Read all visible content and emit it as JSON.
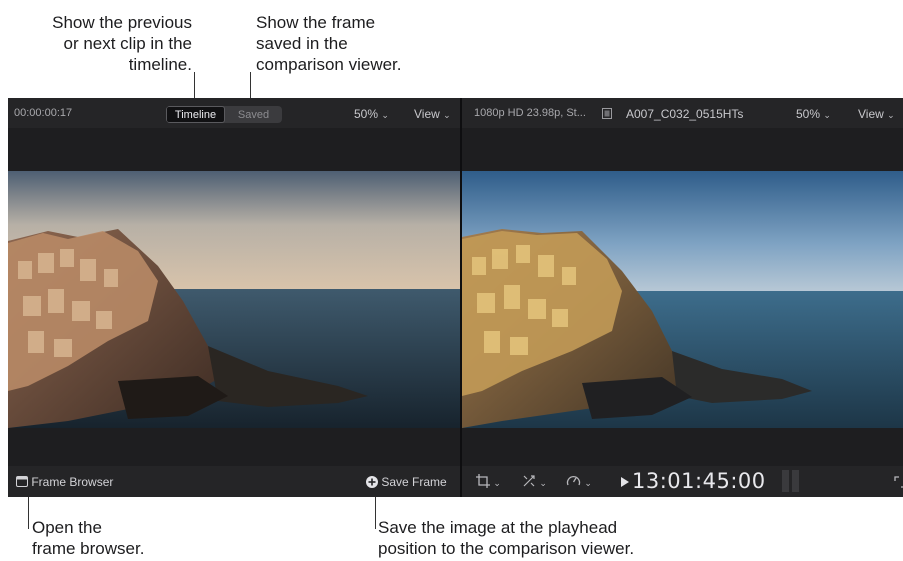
{
  "callouts": {
    "prev_next": "Show the previous\nor next clip in the\ntimeline.",
    "saved_frame": "Show the frame\nsaved in the\ncomparison viewer.",
    "open_browser": "Open the\nframe browser.",
    "save_image": "Save the image at the playhead\nposition to the comparison viewer."
  },
  "left_viewer": {
    "timecode": "00:00:00:17",
    "segment": {
      "timeline_label": "Timeline",
      "saved_label": "Saved",
      "selected": "Timeline"
    },
    "zoom": "50%",
    "view_label": "View",
    "frame_browser_label": "Frame Browser",
    "save_frame_label": "Save Frame"
  },
  "right_viewer": {
    "format": "1080p HD 23.98p, St...",
    "clip_name": "A007_C032_0515HTs",
    "zoom": "50%",
    "view_label": "View",
    "timecode": "13:01:45:00"
  },
  "icons": {
    "chevron": "⌄",
    "crop": "crop-icon",
    "transform": "transform-icon",
    "retime": "retime-icon",
    "play": "play-icon",
    "fullscreen": "fullscreen-icon",
    "film": "film-icon",
    "frame_browser": "frame-browser-icon",
    "save_frame": "plus-circle-icon"
  },
  "colors": {
    "app_bg": "#1c1c1e",
    "bar_bg": "#252527",
    "text": "#c8c8cc",
    "callout_text": "#1d1d1f"
  }
}
